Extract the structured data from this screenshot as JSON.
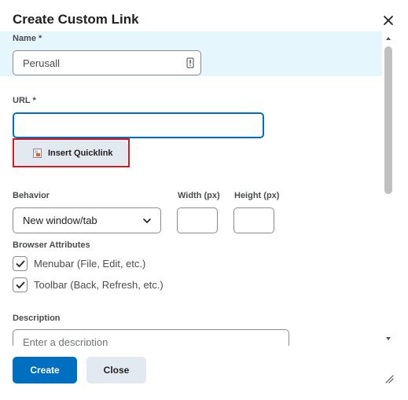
{
  "dialog": {
    "title": "Create Custom Link",
    "close_icon": "close-icon"
  },
  "form": {
    "name": {
      "label": "Name *",
      "value": "Perusall",
      "icon": "password-manager-icon"
    },
    "url": {
      "label": "URL *",
      "value": "",
      "placeholder": ""
    },
    "quicklink": {
      "label": "Insert Quicklink",
      "icon": "quicklink-icon"
    },
    "behavior": {
      "label": "Behavior",
      "selected": "New window/tab",
      "icon": "chevron-down-icon"
    },
    "width": {
      "label": "Width (px)",
      "value": ""
    },
    "height": {
      "label": "Height (px)",
      "value": ""
    },
    "browser_attributes": {
      "label": "Browser Attributes",
      "options": [
        {
          "label": "Menubar (File, Edit, etc.)",
          "checked": true
        },
        {
          "label": "Toolbar (Back, Refresh, etc.)",
          "checked": true
        }
      ]
    },
    "description": {
      "label": "Description",
      "placeholder": "Enter a description"
    }
  },
  "footer": {
    "create_label": "Create",
    "close_label": "Close"
  },
  "colors": {
    "primary": "#006fbf",
    "highlight_band": "#e6f6fd",
    "quicklink_outline": "#e0141d",
    "secondary_button": "#e3e9f1"
  }
}
